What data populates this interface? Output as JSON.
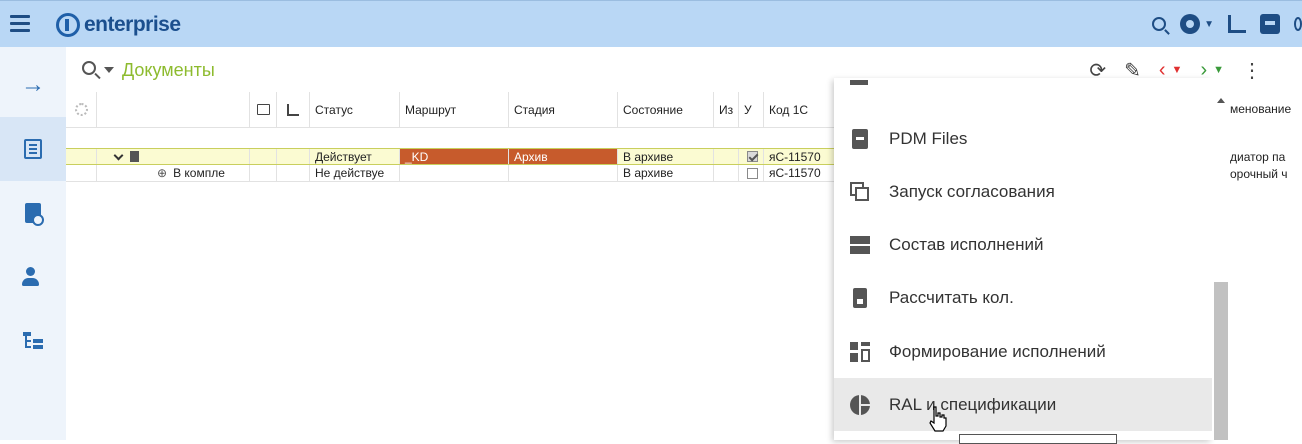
{
  "app": {
    "logo_text": "enterprise"
  },
  "topbar": {
    "icons": [
      "search-icon",
      "gear-icon",
      "edit-icon",
      "box-icon"
    ]
  },
  "sidebar": {
    "items": [
      "arrow-right-icon",
      "book-icon",
      "document-icon",
      "user-icon",
      "tree-icon"
    ]
  },
  "toolbar": {
    "title": "Документы",
    "icons": [
      "refresh-icon",
      "pencil-icon",
      "prev-icon",
      "next-icon",
      "more-icon"
    ]
  },
  "grid": {
    "columns": [
      "Статус",
      "Маршрут",
      "Стадия",
      "Состояние",
      "Из",
      "У",
      "Код 1С"
    ],
    "rows": [
      {
        "name": "",
        "status": "Действует",
        "route": "_KD",
        "stage": "Архив",
        "state": "В архиве",
        "checked": true,
        "code": "яС-11570"
      },
      {
        "name": "В компле",
        "status": "Не действуе",
        "route": "",
        "stage": "",
        "state": "В архиве",
        "checked": false,
        "code": "яС-11570"
      }
    ]
  },
  "right_column": {
    "header": "менование",
    "rows": [
      "диатор па",
      "орочный ч"
    ]
  },
  "menu": {
    "items": [
      {
        "label": "PDM Files",
        "icon": "file-export-icon"
      },
      {
        "label": "Запуск согласования",
        "icon": "approval-icon"
      },
      {
        "label": "Состав исполнений",
        "icon": "server-icon"
      },
      {
        "label": "Рассчитать кол.",
        "icon": "calc-doc-icon"
      },
      {
        "label": "Формирование исполнений",
        "icon": "layout-icon"
      },
      {
        "label": "RAL и спецификации",
        "icon": "pie-icon"
      }
    ]
  },
  "colors": {
    "topbar_bg": "#b9d7f5",
    "title_green": "#8dbb2e",
    "route_orange": "#c75b2c",
    "row_highlight": "#fbfbd2"
  }
}
